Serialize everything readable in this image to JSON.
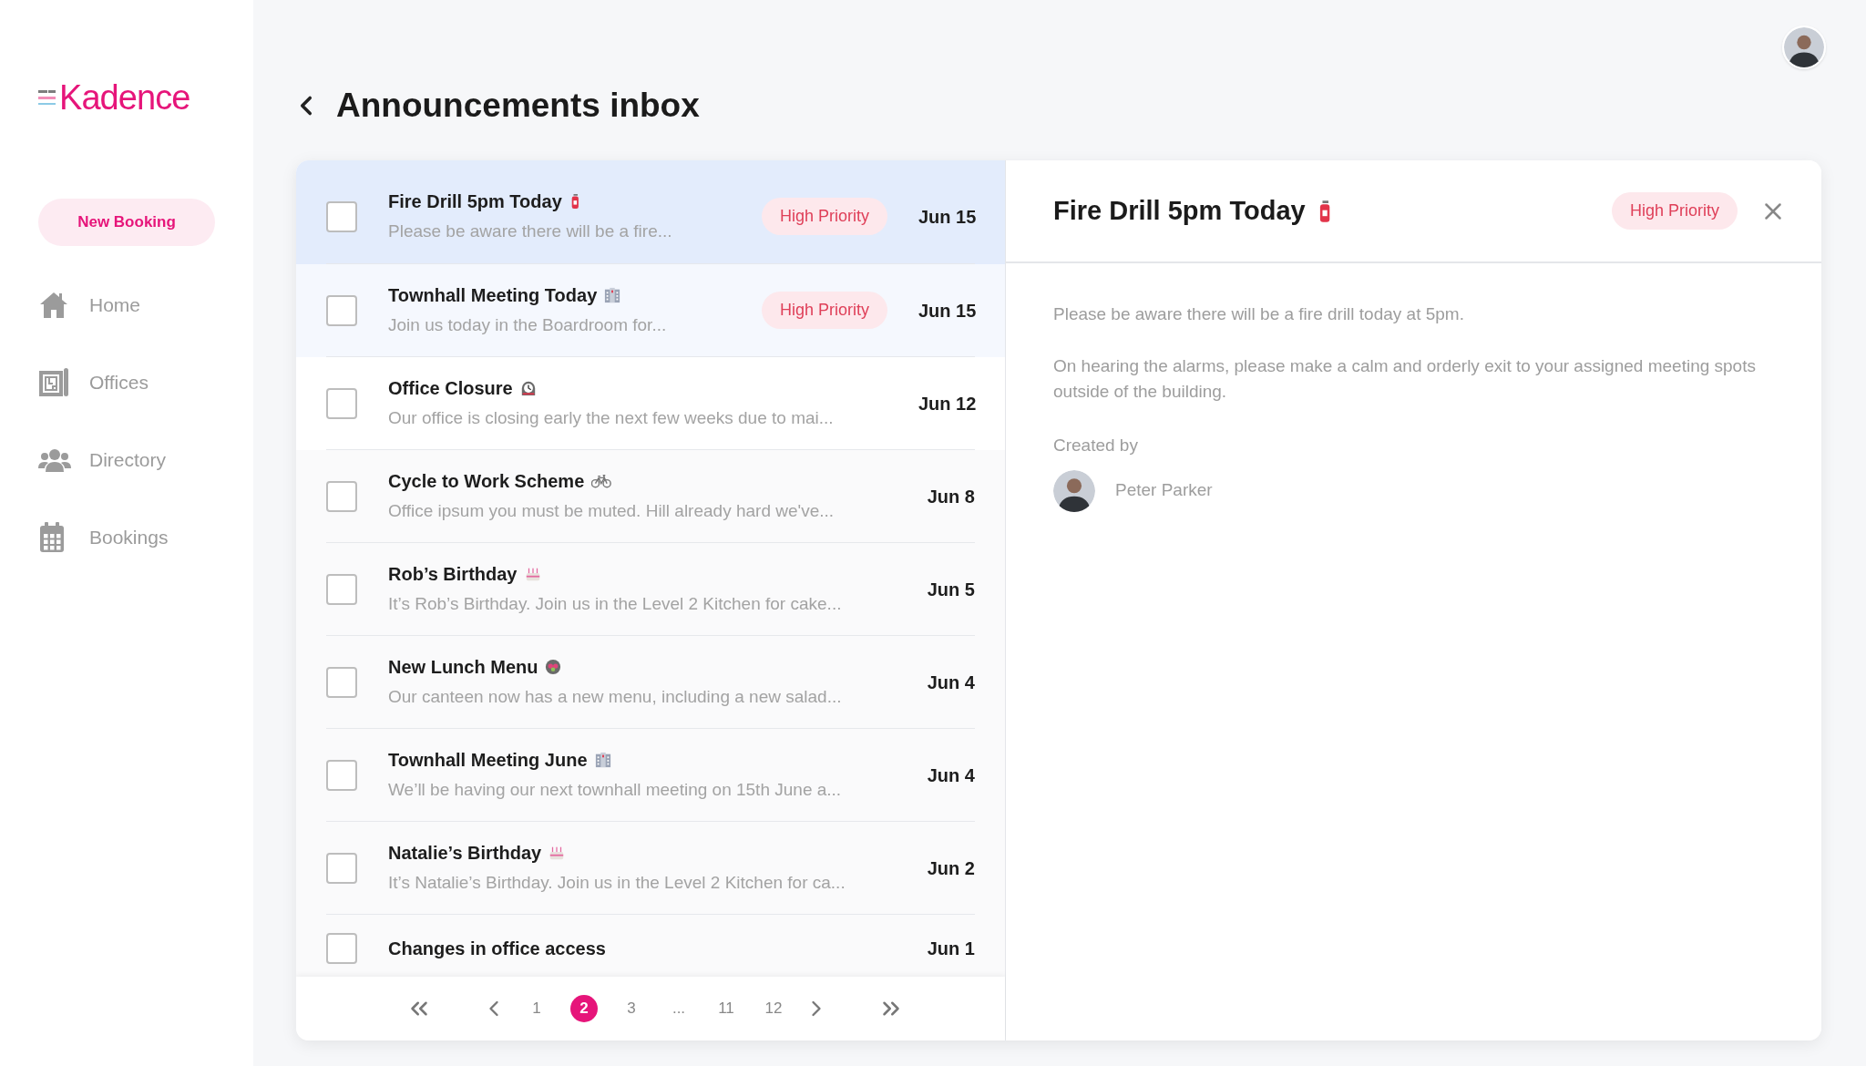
{
  "logo": {
    "text": "Kadence"
  },
  "new_booking_button": "New Booking",
  "nav": [
    {
      "label": "Home"
    },
    {
      "label": "Offices"
    },
    {
      "label": "Directory"
    },
    {
      "label": "Bookings"
    }
  ],
  "page_title": "Announcements inbox",
  "announcements": [
    {
      "title": "Fire Drill 5pm Today",
      "preview": "Please be aware there will be a fire...",
      "badge": "High Priority",
      "date": "Jun 15",
      "selected": true,
      "checked": false
    },
    {
      "title": "Townhall Meeting Today",
      "preview": "Join us today in the Boardroom for...",
      "badge": "High Priority",
      "date": "Jun 15",
      "selected": false,
      "checked": false
    },
    {
      "title": "Office Closure",
      "preview": "Our office is closing early the next few weeks due to mai...",
      "date": "Jun 12",
      "selected": false,
      "checked": false
    },
    {
      "title": "Cycle to Work Scheme",
      "preview": "Office ipsum you must be muted. Hill already hard we've...",
      "date": "Jun 8",
      "selected": false,
      "checked": false
    },
    {
      "title": "Rob’s Birthday",
      "preview": "It’s Rob’s Birthday. Join us in the Level 2 Kitchen for cake...",
      "date": "Jun 5",
      "selected": false,
      "checked": false
    },
    {
      "title": "New Lunch Menu",
      "preview": "Our canteen now has a new menu, including a new salad...",
      "date": "Jun 4",
      "selected": false,
      "checked": false
    },
    {
      "title": "Townhall Meeting June",
      "preview": "We’ll be having our next townhall meeting on 15th June a...",
      "date": "Jun 4",
      "selected": false,
      "checked": false
    },
    {
      "title": "Natalie’s Birthday",
      "preview": "It’s Natalie’s Birthday. Join us in the Level 2 Kitchen for ca...",
      "date": "Jun 2",
      "selected": false,
      "checked": false
    },
    {
      "title": "Changes in office access",
      "date": "Jun 1",
      "selected": false,
      "checked": false
    }
  ],
  "pagination": [
    {
      "label": "1",
      "selected": false
    },
    {
      "label": "2",
      "selected": true
    },
    {
      "label": "3",
      "selected": false
    },
    {
      "label": "...",
      "selected": false
    },
    {
      "label": "11",
      "selected": false
    },
    {
      "label": "12",
      "selected": false
    }
  ],
  "detail": {
    "title": "Fire Drill 5pm Today",
    "badge": "High Priority",
    "paragraphs": [
      "Please be aware there will be a fire drill today at 5pm.",
      "On hearing the alarms, please make a calm and orderly exit to your assigned meeting spots outside of the building."
    ],
    "created_by_label": "Created by",
    "author": "Peter Parker"
  }
}
